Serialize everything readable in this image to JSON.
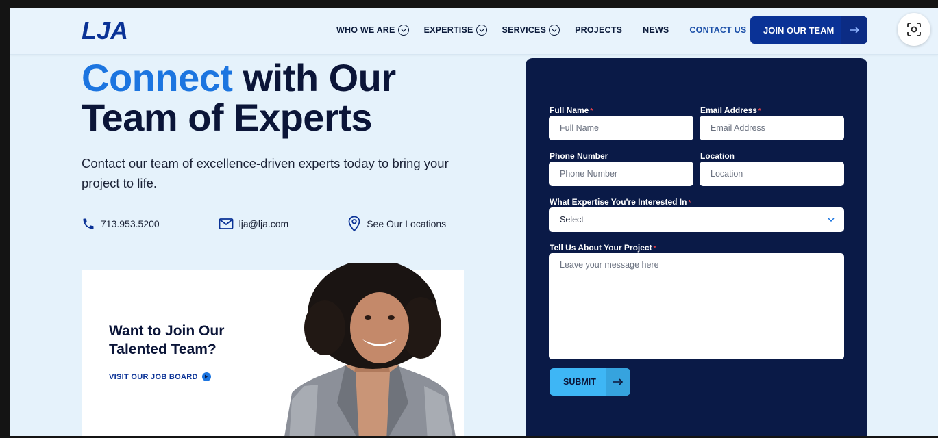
{
  "brand": {
    "logo_text": "LJA",
    "accent": "#1c75e0",
    "navy": "#0a1a47",
    "primary": "#0a3296"
  },
  "nav": {
    "items": [
      {
        "label": "WHO WE ARE",
        "dropdown": true
      },
      {
        "label": "EXPERTISE",
        "dropdown": true
      },
      {
        "label": "SERVICES",
        "dropdown": true
      },
      {
        "label": "PROJECTS",
        "dropdown": false
      },
      {
        "label": "NEWS",
        "dropdown": false
      },
      {
        "label": "CONTACT US",
        "dropdown": false,
        "active": true
      }
    ],
    "cta_label": "JOIN OUR TEAM"
  },
  "hero": {
    "title_accent": "Connect",
    "title_rest_line1": " with Our",
    "title_line2": "Team of Experts",
    "subtitle": "Contact our team of excellence-driven experts today to bring your project to life."
  },
  "contacts": {
    "phone": "713.953.5200",
    "email": "lja@lja.com",
    "locations": "See Our Locations"
  },
  "join_card": {
    "title": "Want to Join Our\nTalented Team?",
    "link_label": "VISIT OUR JOB BOARD"
  },
  "form": {
    "full_name": {
      "label": "Full Name",
      "placeholder": "Full Name",
      "required": true
    },
    "email": {
      "label": "Email Address",
      "placeholder": "Email Address",
      "required": true
    },
    "phone": {
      "label": "Phone Number",
      "placeholder": "Phone Number",
      "required": false
    },
    "location": {
      "label": "Location",
      "placeholder": "Location",
      "required": false
    },
    "expertise": {
      "label": "What Expertise You're Interested In",
      "selected": "Select",
      "required": true
    },
    "project": {
      "label": "Tell Us About Your Project",
      "placeholder": "Leave your message here",
      "required": true
    },
    "submit_label": "SUBMIT",
    "required_mark": "*"
  },
  "icons": [
    "phone-icon",
    "mail-icon",
    "location-pin-icon",
    "arrow-right-icon",
    "chevron-down-icon",
    "lens-icon"
  ]
}
